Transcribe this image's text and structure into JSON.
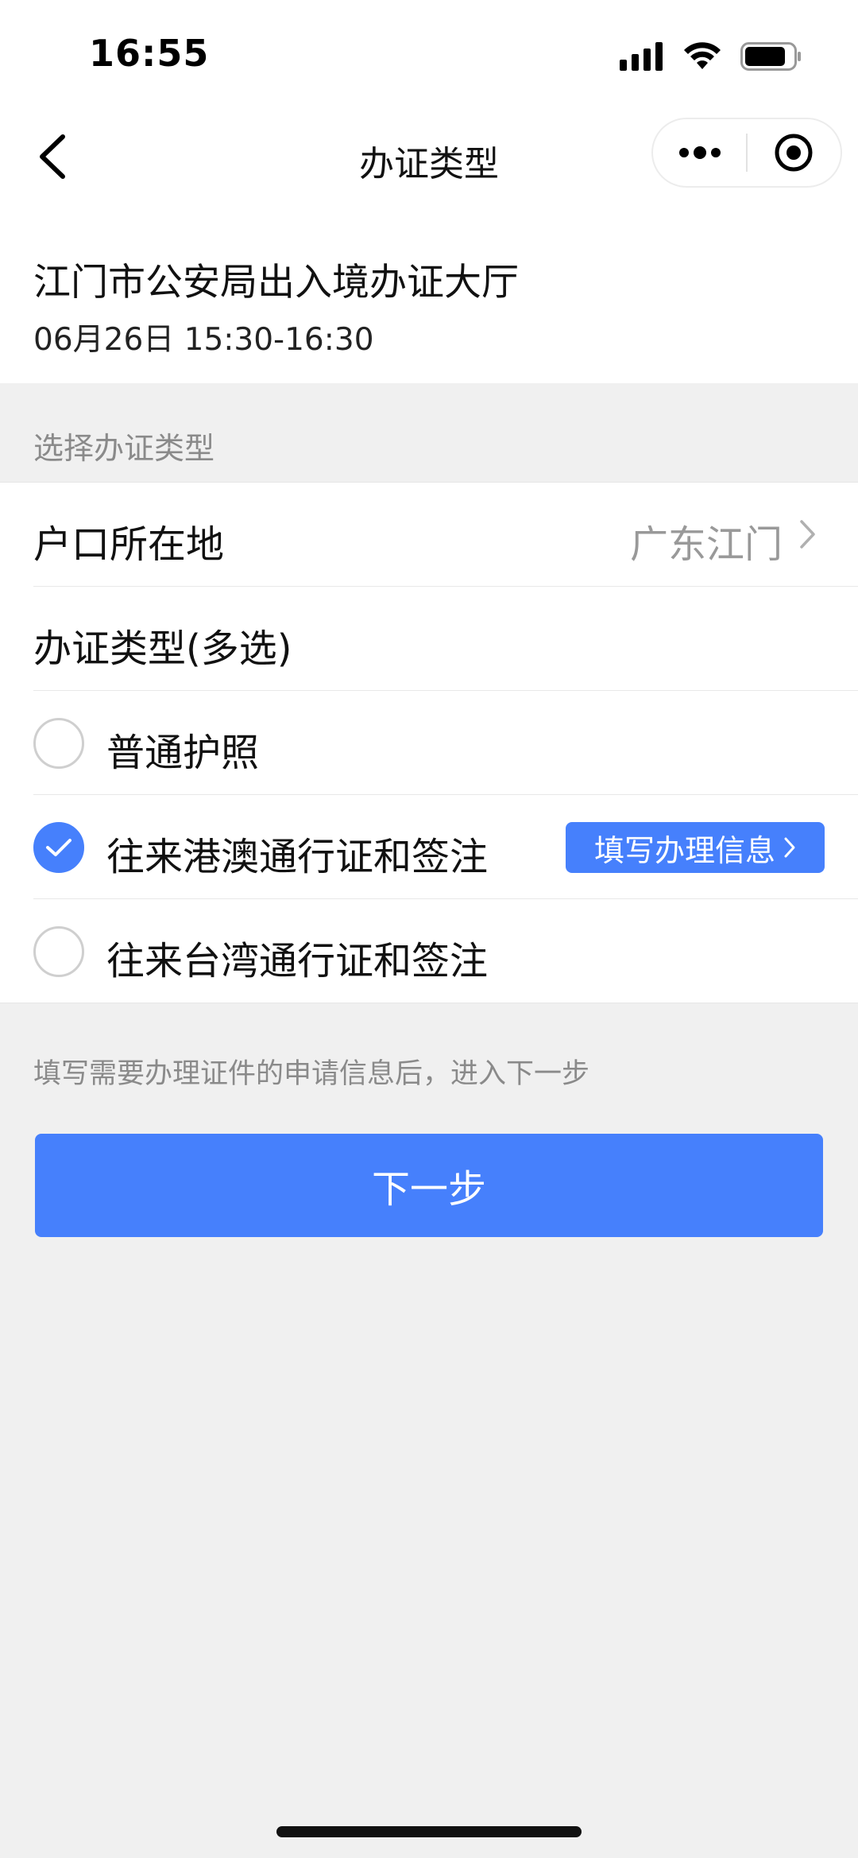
{
  "status_bar": {
    "time": "16:55",
    "icons": [
      "cellular-signal-icon",
      "wifi-icon",
      "battery-icon"
    ]
  },
  "nav": {
    "title": "办证类型",
    "icons": [
      "back-arrow-icon",
      "more-dots-icon",
      "record-target-icon"
    ]
  },
  "header": {
    "hall_name": "江门市公安局出入境办证大厅",
    "appointment_time": "06月26日 15:30-16:30"
  },
  "section": {
    "label": "选择办证类型"
  },
  "form": {
    "household": {
      "label": "户口所在地",
      "value": "广东江门"
    },
    "type_heading": "办证类型(多选)",
    "options": [
      {
        "label": "普通护照",
        "checked": false
      },
      {
        "label": "往来港澳通行证和签注",
        "checked": true,
        "action_label": "填写办理信息"
      },
      {
        "label": "往来台湾通行证和签注",
        "checked": false
      }
    ]
  },
  "hint": "填写需要办理证件的申请信息后，进入下一步",
  "next_button": "下一步",
  "colors": {
    "accent": "#4680fc",
    "background": "#f0f0f0",
    "muted_text": "#8a8a8a"
  }
}
